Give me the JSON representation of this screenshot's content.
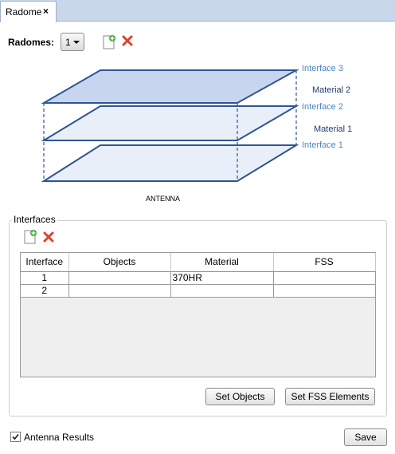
{
  "tab": {
    "label": "Radome",
    "close": "×"
  },
  "radomes": {
    "label": "Radomes:",
    "selected": "1"
  },
  "diagram": {
    "interfaces": [
      "Interface 3",
      "Interface 2",
      "Interface 1"
    ],
    "materials": [
      "Material 2",
      "Material 1"
    ],
    "antenna": "ANTENNA",
    "colors": {
      "label_blue": "#4a86c5",
      "dark_blue": "#1f3b6e",
      "line": "#2f5496",
      "fill": "#e9eff8",
      "fill_top": "#c7d6ee"
    }
  },
  "interfaces": {
    "title": "Interfaces",
    "columns": [
      "Interface",
      "Objects",
      "Material",
      "FSS"
    ],
    "rows": [
      {
        "interface": "1",
        "objects": "",
        "material": "370HR",
        "fss": ""
      },
      {
        "interface": "2",
        "objects": "",
        "material": "",
        "fss": ""
      }
    ],
    "set_objects": "Set Objects",
    "set_fss": "Set FSS Elements"
  },
  "footer": {
    "antenna_results": "Antenna Results",
    "antenna_results_checked": true,
    "save": "Save"
  },
  "icons": {
    "add": "add-document-icon",
    "delete": "delete-x-icon"
  }
}
